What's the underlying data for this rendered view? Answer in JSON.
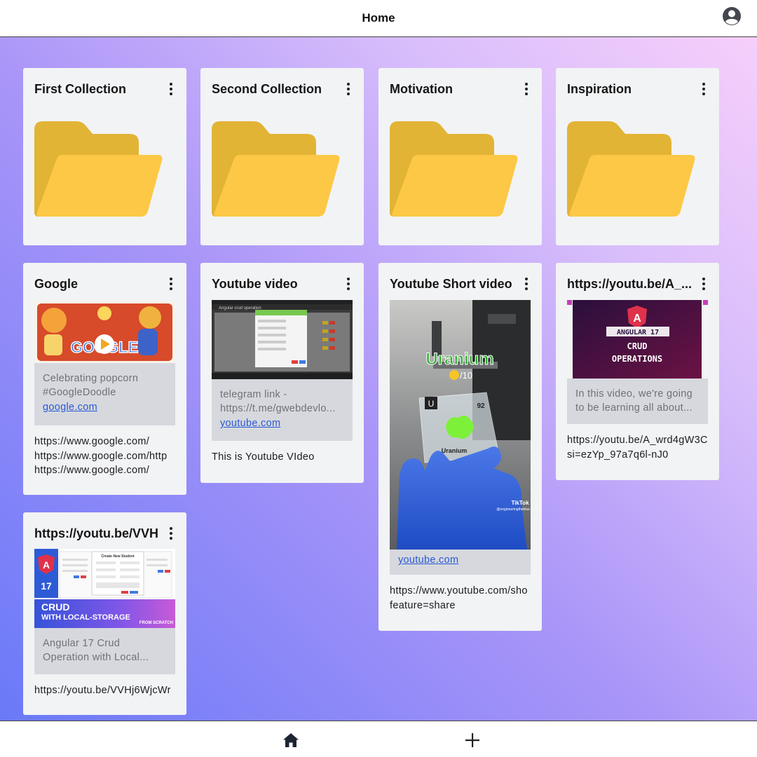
{
  "header": {
    "title": "Home"
  },
  "collections": [
    {
      "title": "First Collection"
    },
    {
      "title": "Second Collection"
    },
    {
      "title": "Motivation"
    },
    {
      "title": "Inspiration"
    }
  ],
  "links": [
    {
      "title": "Google",
      "thumb_text": "GOOGLE",
      "description": "Celebrating popcorn #GoogleDoodle",
      "domain": "google.com",
      "urls": [
        "https://www.google.com/",
        "https://www.google.com/http",
        "https://www.google.com/"
      ]
    },
    {
      "title": "Youtube video",
      "thumb_heading": "Angular crud operation",
      "description": "telegram link - https://t.me/gwebdevlo...",
      "domain": "youtube.com",
      "note": "This is Youtube VIdeo"
    },
    {
      "title": "Youtube Short video",
      "thumb_word": "Uranium",
      "thumb_rating": "/10",
      "thumb_element_symbol": "U",
      "thumb_element_number": "92",
      "thumb_element_name": "Uranium",
      "thumb_brand": "TikTok",
      "thumb_handle": "@engineeringtheblue",
      "domain": "youtube.com",
      "urls": [
        "https://www.youtube.com/sho",
        "feature=share"
      ]
    },
    {
      "title": "https://youtu.be/A_...",
      "thumb_line1": "ANGULAR 17",
      "thumb_line2": "CRUD",
      "thumb_line3": "OPERATIONS",
      "description": "In this video, we're going to be learning all about...",
      "urls": [
        "https://youtu.be/A_wrd4gW3C",
        "si=ezYp_97a7q6l-nJ0"
      ]
    },
    {
      "title": "https://youtu.be/VVH",
      "thumb_badge": "17",
      "thumb_heading": "Create New Student",
      "thumb_line1": "CRUD",
      "thumb_line2": "WITH LOCAL-STORAGE",
      "thumb_line3": "FROM SCRATCH",
      "description": "Angular 17 Crud Operation with Local...",
      "urls": [
        "https://youtu.be/VVHj6WjcWr"
      ]
    }
  ],
  "colors": {
    "folder_back": "#e2b435",
    "folder_front": "#fdc845",
    "link": "#2a58d4",
    "card": "#f2f3f5"
  },
  "icons": {
    "profile": "account-circle-icon",
    "home": "home-icon",
    "add": "plus-icon",
    "menu": "more-vert-icon"
  }
}
